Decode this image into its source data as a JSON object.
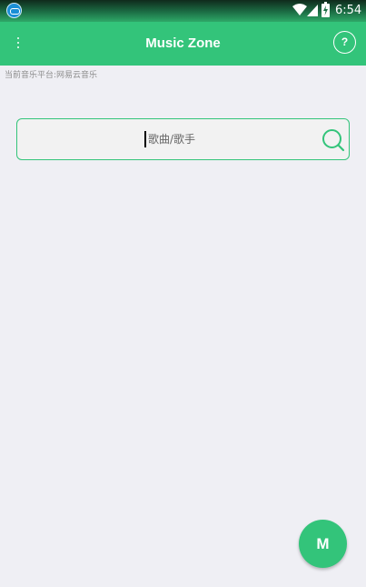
{
  "status_bar": {
    "time": "6:54",
    "icons": [
      "app-notification-icon",
      "wifi-icon",
      "signal-icon",
      "battery-charging-icon"
    ]
  },
  "toolbar": {
    "title": "Music Zone",
    "menu_icon": "overflow-menu-icon",
    "help_label": "?"
  },
  "platform_info": "当前音乐平台:网易云音乐",
  "search": {
    "value": "",
    "placeholder": "歌曲/歌手",
    "icon": "search-icon"
  },
  "fab": {
    "label": "M"
  },
  "colors": {
    "accent": "#33c47a",
    "background": "#efeff4",
    "hint_text": "#8e8e8e"
  }
}
